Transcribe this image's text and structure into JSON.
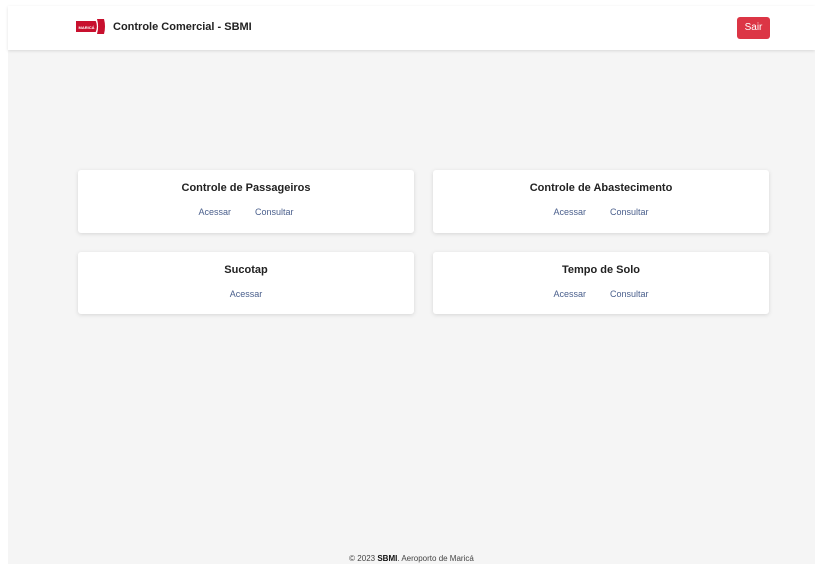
{
  "header": {
    "title": "Controle Comercial - SBMI",
    "logo_text": "MARICÁ",
    "logout_label": "Sair"
  },
  "cards": [
    {
      "title": "Controle de Passageiros",
      "access_label": "Acessar",
      "consult_label": "Consultar"
    },
    {
      "title": "Controle de Abastecimento",
      "access_label": "Acessar",
      "consult_label": "Consultar"
    },
    {
      "title": "Sucotap",
      "access_label": "Acessar"
    },
    {
      "title": "Tempo de Solo",
      "access_label": "Acessar",
      "consult_label": "Consultar"
    }
  ],
  "footer": {
    "prefix": "© 2023",
    "brand": "SBMI",
    "suffix": ". Aeroporto de Maricá"
  },
  "colors": {
    "accent": "#dc3545",
    "link": "#4a5f8c",
    "background": "#f5f5f5"
  }
}
